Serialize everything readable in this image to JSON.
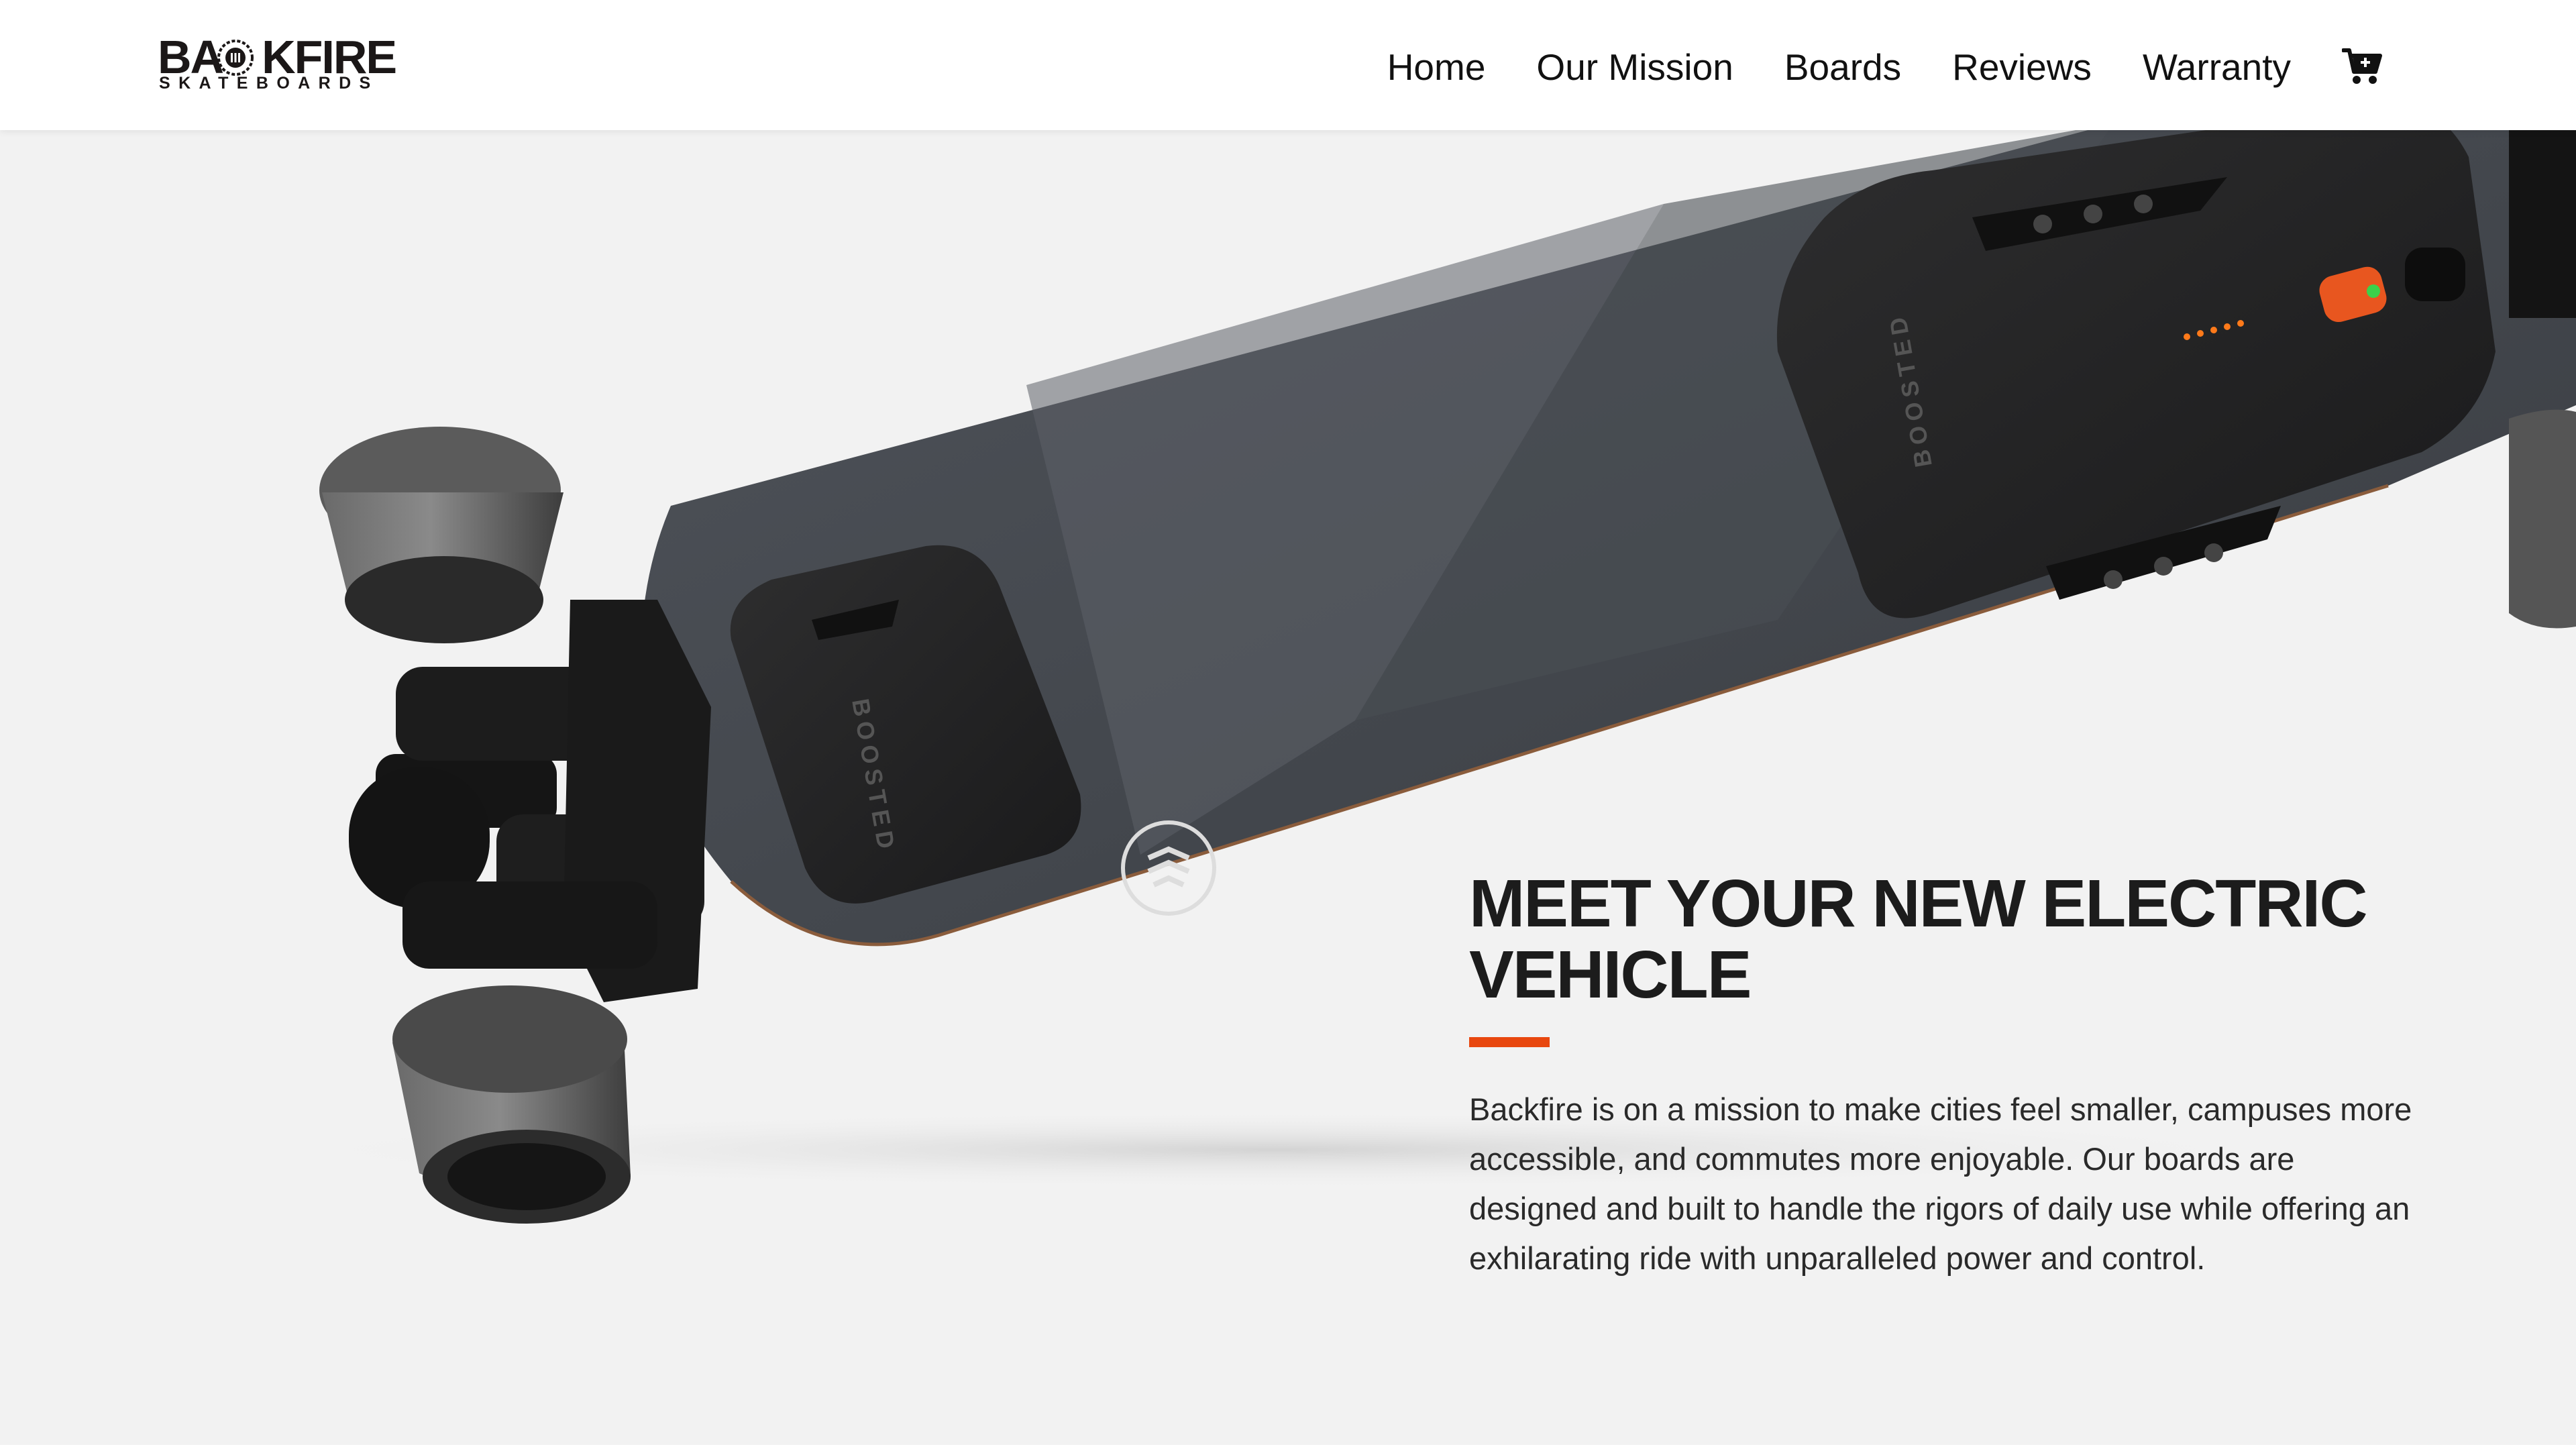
{
  "brand": {
    "name": "BACKFIRE",
    "wordmark_left": "BA",
    "wordmark_right": "KFIRE",
    "subtitle": "SKATEBOARDS"
  },
  "nav": {
    "items": [
      {
        "label": "Home"
      },
      {
        "label": "Our Mission"
      },
      {
        "label": "Boards"
      },
      {
        "label": "Reviews"
      },
      {
        "label": "Warranty"
      }
    ],
    "cart_icon": "shopping-cart-icon"
  },
  "hero": {
    "headline": "MEET YOUR NEW ELECTRIC VEHICLE",
    "body": "Backfire is on a mission to make cities feel smaller, campuses more accessible, and commutes more enjoyable. Our boards are designed and built to handle the rigors of daily use while offering an exhilarating ride with unparalleled power and control.",
    "image_alt": "electric skateboard underside",
    "board_print_1": "BOOSTED",
    "board_print_2": "BOOSTED"
  },
  "colors": {
    "accent": "#e8470f",
    "header_bg": "#ffffff",
    "page_bg": "#f2f2f2",
    "text": "#1c1c1c"
  }
}
